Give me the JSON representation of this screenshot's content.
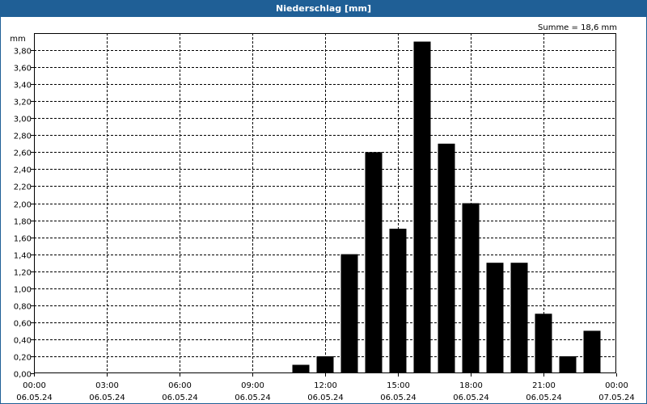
{
  "window": {
    "title": "Niederschlag [mm]"
  },
  "chart_data": {
    "type": "bar",
    "title": "Niederschlag [mm]",
    "ylabel": "mm",
    "xlabel": "",
    "annotation": "Summe = 18,6 mm",
    "ylim": [
      0,
      4.0
    ],
    "yticks": [
      "0,00",
      "0,20",
      "0,40",
      "0,60",
      "0,80",
      "1,00",
      "1,20",
      "1,40",
      "1,60",
      "1,80",
      "2,00",
      "2,20",
      "2,40",
      "2,60",
      "2,80",
      "3,00",
      "3,20",
      "3,40",
      "3,60",
      "3,80"
    ],
    "xlim_hours": [
      0,
      24
    ],
    "xticks": [
      {
        "time": "00:00",
        "date": "06.05.24"
      },
      {
        "time": "03:00",
        "date": "06.05.24"
      },
      {
        "time": "06:00",
        "date": "06.05.24"
      },
      {
        "time": "09:00",
        "date": "06.05.24"
      },
      {
        "time": "12:00",
        "date": "06.05.24"
      },
      {
        "time": "15:00",
        "date": "06.05.24"
      },
      {
        "time": "18:00",
        "date": "06.05.24"
      },
      {
        "time": "21:00",
        "date": "06.05.24"
      },
      {
        "time": "00:00",
        "date": "07.05.24"
      }
    ],
    "bar_color": "#000000",
    "grid": true,
    "bars": [
      {
        "time": "11:00",
        "value": 0.1
      },
      {
        "time": "12:00",
        "value": 0.2
      },
      {
        "time": "13:00",
        "value": 1.4
      },
      {
        "time": "14:00",
        "value": 2.6
      },
      {
        "time": "15:00",
        "value": 1.7
      },
      {
        "time": "16:00",
        "value": 3.9
      },
      {
        "time": "17:00",
        "value": 2.7
      },
      {
        "time": "18:00",
        "value": 2.0
      },
      {
        "time": "19:00",
        "value": 1.3
      },
      {
        "time": "20:00",
        "value": 1.3
      },
      {
        "time": "21:00",
        "value": 0.7
      },
      {
        "time": "22:00",
        "value": 0.2
      },
      {
        "time": "23:00",
        "value": 0.5
      }
    ]
  }
}
